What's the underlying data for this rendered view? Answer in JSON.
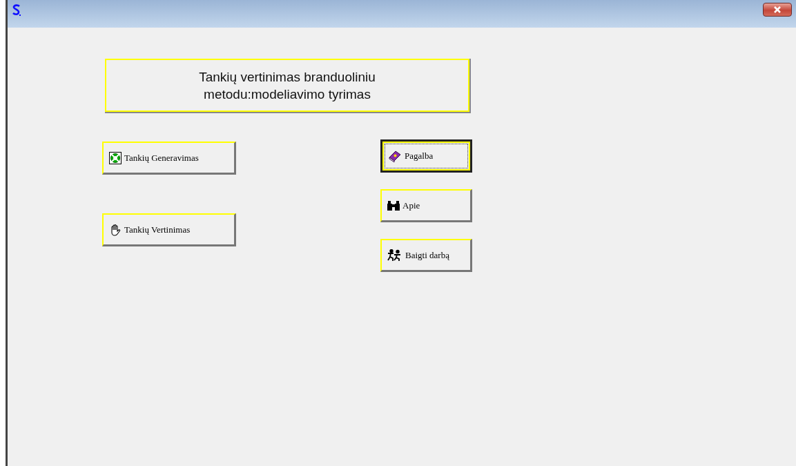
{
  "title_panel": {
    "lines": [
      "Tankių vertinimas branduoliniu",
      "metodu:modeliavimo tyrimas"
    ]
  },
  "left_buttons": [
    {
      "label": "Tankių Generavimas",
      "selected": false
    },
    {
      "label": "Tankių Vertinimas",
      "selected": false
    }
  ],
  "right_buttons": [
    {
      "label": "Pagalba",
      "selected": true
    },
    {
      "label": "Apie",
      "selected": false
    },
    {
      "label": "Baigti darbą",
      "selected": false
    }
  ]
}
